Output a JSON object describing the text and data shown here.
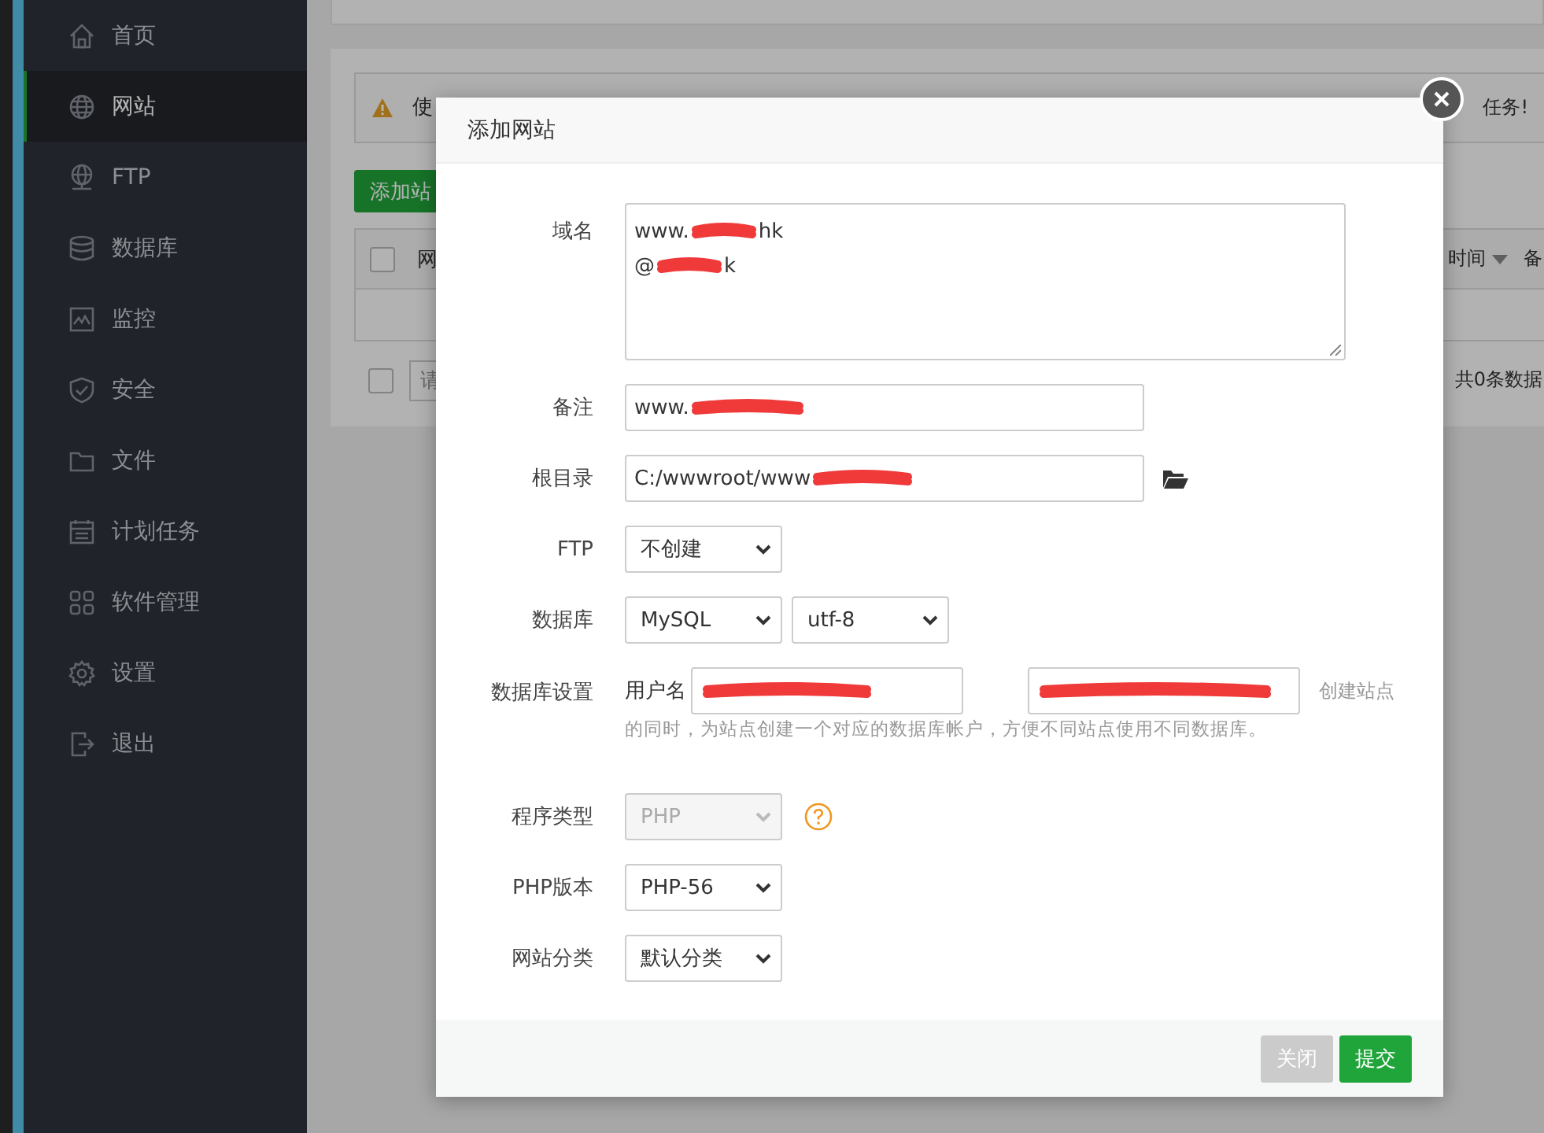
{
  "sidebar": {
    "items": [
      {
        "label": "首页",
        "selected": false
      },
      {
        "label": "网站",
        "selected": true
      },
      {
        "label": "FTP",
        "selected": false
      },
      {
        "label": "数据库",
        "selected": false
      },
      {
        "label": "监控",
        "selected": false
      },
      {
        "label": "安全",
        "selected": false
      },
      {
        "label": "文件",
        "selected": false
      },
      {
        "label": "计划任务",
        "selected": false
      },
      {
        "label": "软件管理",
        "selected": false
      },
      {
        "label": "设置",
        "selected": false
      },
      {
        "label": "退出",
        "selected": false
      }
    ]
  },
  "background": {
    "warning": {
      "start": "使",
      "end": "任务!"
    },
    "add_button": "添加站",
    "header_checkbox": {
      "checked": false
    },
    "table_columns": [
      "网",
      "时间",
      "备"
    ],
    "footer_checkbox": {
      "checked": false
    },
    "search_placeholder": "请",
    "total": "共0条数据"
  },
  "modal": {
    "title": "添加网站",
    "fields": [
      {
        "label": "域名",
        "kind": "textarea",
        "lines": [
          [
            "www.",
            "hk"
          ],
          [
            "@",
            "k"
          ]
        ],
        "redacted": true
      },
      {
        "label": "备注",
        "kind": "text",
        "value": "www.",
        "redacted": true
      },
      {
        "label": "根目录",
        "kind": "path",
        "value": "C:/wwwroot/www",
        "redacted": true
      },
      {
        "label": "FTP",
        "kind": "select",
        "options": [
          {
            "value": "不创建",
            "disabled": false
          }
        ]
      },
      {
        "label": "数据库",
        "kind": "select",
        "options": [
          {
            "value": "MySQL",
            "disabled": false
          },
          {
            "value": "utf-8",
            "disabled": false
          }
        ]
      },
      {
        "label": "数据库设置",
        "kind": "db",
        "prefix": "用户名",
        "redacted": true,
        "hint": [
          "创建站点",
          "的同时，为站点创建一个对应的数据库帐户，方便不同站点使用不同数据库。"
        ]
      },
      {
        "label": "程序类型",
        "kind": "help-select",
        "options": [
          {
            "value": "PHP",
            "disabled": true
          }
        ]
      },
      {
        "label": "PHP版本",
        "kind": "select",
        "options": [
          {
            "value": "PHP-56",
            "disabled": false
          }
        ]
      },
      {
        "label": "网站分类",
        "kind": "select",
        "options": [
          {
            "value": "默认分类",
            "disabled": false
          }
        ]
      }
    ],
    "buttons": [
      {
        "label": "关闭",
        "kind": "secondary"
      },
      {
        "label": "提交",
        "kind": "primary"
      }
    ]
  }
}
